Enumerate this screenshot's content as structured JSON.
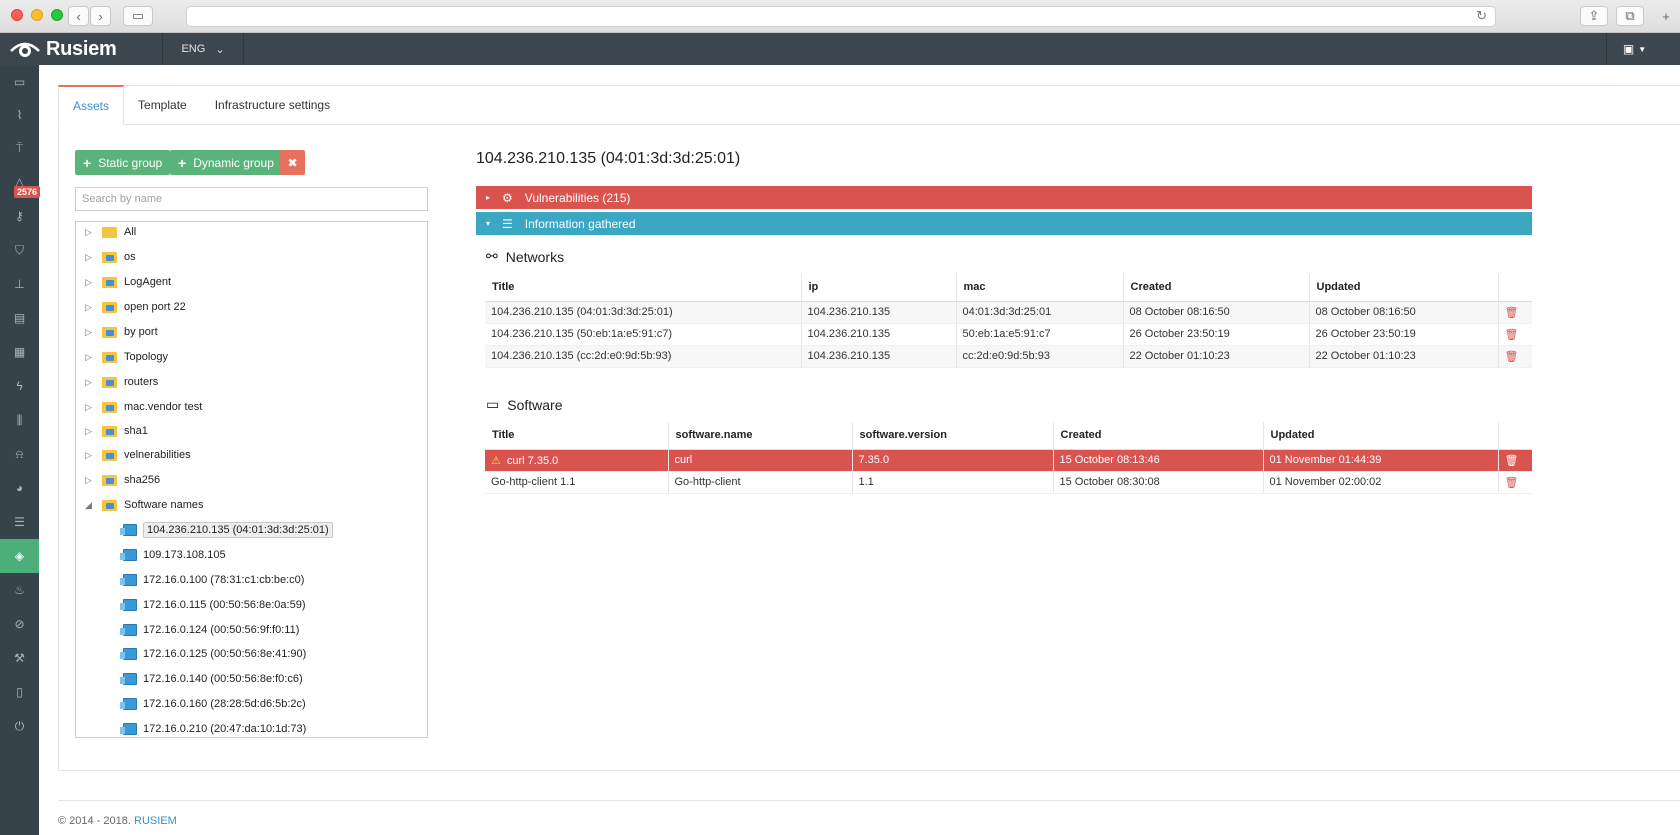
{
  "app": {
    "brand": "Rusiem",
    "language": "ENG",
    "alert_count": "2576"
  },
  "tabs": [
    {
      "label": "Assets"
    },
    {
      "label": "Template"
    },
    {
      "label": "Infrastructure settings"
    }
  ],
  "toolbar": {
    "static_group": "Static group",
    "dynamic_group": "Dynamic group",
    "delete": "✖"
  },
  "search": {
    "placeholder": "Search by name"
  },
  "tree": {
    "groups": [
      "All",
      "os",
      "LogAgent",
      "open port 22",
      "by port",
      "Topology",
      "routers",
      "mac.vendor test",
      "sha1",
      "velnerabilities",
      "sha256",
      "Software names"
    ],
    "hosts": [
      "104.236.210.135 (04:01:3d:3d:25:01)",
      "109.173.108.105",
      "172.16.0.100 (78:31:c1:cb:be:c0)",
      "172.16.0.115 (00:50:56:8e:0a:59)",
      "172.16.0.124 (00:50:56:9f:f0:11)",
      "172.16.0.125 (00:50:56:8e:41:90)",
      "172.16.0.140 (00:50:56:8e:f0:c6)",
      "172.16.0.160 (28:28:5d:d6:5b:2c)",
      "172.16.0.210 (20:47:da:10:1d:73)"
    ]
  },
  "detail": {
    "title": "104.236.210.135 (04:01:3d:3d:25:01)",
    "vulnerabilities": "Vulnerabilities (215)",
    "info": "Information gathered",
    "networks": {
      "title": "Networks",
      "headers": [
        "Title",
        "ip",
        "mac",
        "Created",
        "Updated"
      ],
      "rows": [
        [
          "104.236.210.135 (04:01:3d:3d:25:01)",
          "104.236.210.135",
          "04:01:3d:3d:25:01",
          "08 October 08:16:50",
          "08 October 08:16:50"
        ],
        [
          "104.236.210.135 (50:eb:1a:e5:91:c7)",
          "104.236.210.135",
          "50:eb:1a:e5:91:c7",
          "26 October 23:50:19",
          "26 October 23:50:19"
        ],
        [
          "104.236.210.135 (cc:2d:e0:9d:5b:93)",
          "104.236.210.135",
          "cc:2d:e0:9d:5b:93",
          "22 October 01:10:23",
          "22 October 01:10:23"
        ]
      ]
    },
    "software": {
      "title": "Software",
      "headers": [
        "Title",
        "software.name",
        "software.version",
        "Created",
        "Updated"
      ],
      "rows": [
        [
          "curl 7.35.0",
          "curl",
          "7.35.0",
          "15 October 08:13:46",
          "01 November 01:44:39"
        ],
        [
          "Go-http-client 1.1",
          "Go-http-client",
          "1.1",
          "15 October 08:30:08",
          "01 November 02:00:02"
        ]
      ]
    }
  },
  "footer": {
    "copyright": "© 2014 - 2018.",
    "link": "RUSIEM"
  }
}
